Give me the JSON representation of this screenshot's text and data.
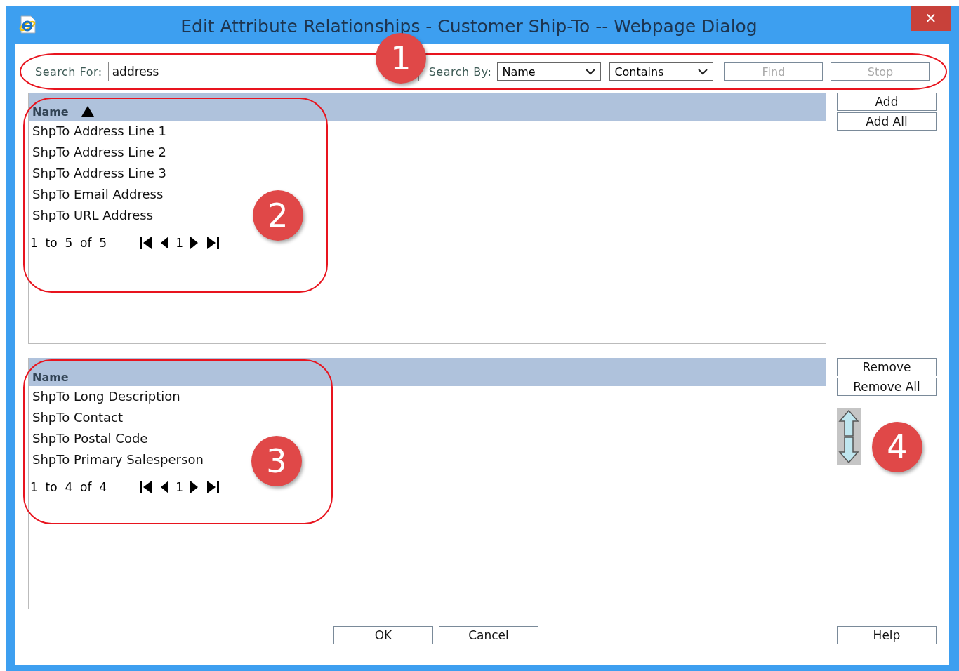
{
  "window": {
    "title": "Edit Attribute Relationships - Customer Ship-To -- Webpage Dialog",
    "close_glyph": "✕"
  },
  "search": {
    "label": "Search For:",
    "value": "address",
    "by_label": "Search By:",
    "by": "Name",
    "match": "Contains",
    "buttons": [
      {
        "label": "Find",
        "disabled": true
      },
      {
        "label": "Stop",
        "disabled": true
      }
    ]
  },
  "available_list": {
    "column": "Name",
    "sorted_ascending": true,
    "rows": [
      "ShpTo Address Line 1",
      "ShpTo Address Line 2",
      "ShpTo Address Line 3",
      "ShpTo Email Address",
      "ShpTo URL Address"
    ],
    "pager": {
      "range": "1  to  5  of  5",
      "page": "1"
    }
  },
  "add_buttons": [
    "Add",
    "Add All"
  ],
  "selected_list": {
    "column": "Name",
    "sorted_ascending": false,
    "rows": [
      "ShpTo Long Description",
      "ShpTo Contact",
      "ShpTo Postal Code",
      "ShpTo Primary Salesperson"
    ],
    "pager": {
      "range": "1  to  4  of  4",
      "page": "1"
    }
  },
  "remove_buttons": [
    "Remove",
    "Remove All"
  ],
  "footer_buttons": [
    "OK",
    "Cancel"
  ],
  "help_button": "Help",
  "callouts": [
    {
      "number": "1"
    },
    {
      "number": "2"
    },
    {
      "number": "3"
    },
    {
      "number": "4"
    }
  ]
}
